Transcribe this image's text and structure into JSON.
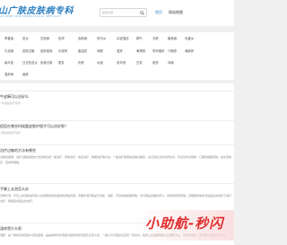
{
  "header": {
    "logo_text": "山广肤皮肤病专科",
    "logo_sub": "AN WISE SKIN DERMATOLOGY SPECIALTY",
    "search_placeholder": "搜索内容",
    "nav": [
      {
        "label": "首页"
      },
      {
        "label": "网站地图"
      }
    ]
  },
  "tags": [
    [
      "青春痘",
      "皮炎",
      "白斑病",
      "班滞",
      "皮肤病",
      "甲沟炎",
      "尖锐湿疣",
      "脚气",
      "冻疮",
      "腋臭病",
      "毛囊炎"
    ],
    [
      "牛皮癣",
      "皮肤过敏",
      "皮肤瘙痒",
      "灰指甲",
      "脂溢性",
      "鸡眼",
      "湿疹",
      "黄褐斑",
      "带状疱疹",
      "汗疱疹",
      "荨麻疹"
    ],
    [
      "扁平疣",
      "日光性皮炎",
      "色素沉着",
      "脱发",
      "疥疮",
      "水痘",
      "老年斑",
      "白发",
      "斑疹",
      "体癣"
    ],
    [
      "湿疹病",
      "痤疮"
    ]
  ],
  "list": [
    {
      "title": "牛皮癣可以治好么",
      "meta": "",
      "tag": "“牛皮癣治疗专科”",
      "desc": ""
    },
    {
      "title": "痘痘在哪些时候要皮肤护理才可以治好呢？",
      "meta": "",
      "tag": "“皮肤病治疗专科”",
      "desc": ""
    },
    {
      "title": "治疗过敏的方法有哪些",
      "meta": "",
      "tag": "",
      "desc": "过敏性疾病：治疗过敏疾病的方法目前包括一般治疗、药物治疗、免疫治疗、物理治疗等方法。一般治疗即避免接触过敏原，在日常生活中注意饮食、环境及作息规律、口服抗组胺药物，如氯雷他定、西替利嗪等。"
    },
    {
      "title": "手脚上长泡怎么办",
      "meta": "",
      "tag": "",
      "desc": "手脚长泡：手足上的泡疹是有些人在夏季经常会遇到的皮肤问题。手脚长泡可能是汗疱疹、湿疹、手足癣等疾病所致，也可能是接触性皮炎、烫伤等原因导致。应根据具体情况在医生的指导下进行治疗，积极配合医生的治疗。"
    },
    {
      "title": "湿疹是什么呢",
      "meta": "",
      "tag": "",
      "desc": "湿疹：是一种常见的皮肤炎症性疾病，是由多种内外因素引起的真皮浅层及表皮炎症，一般认为与变态反应有一定关系。临床上急性期皮损以丘疱疹为主，有渗出倾向，慢性期以苔藓样变为主。"
    }
  ],
  "banner": {
    "text": "小助航-秒闪"
  }
}
